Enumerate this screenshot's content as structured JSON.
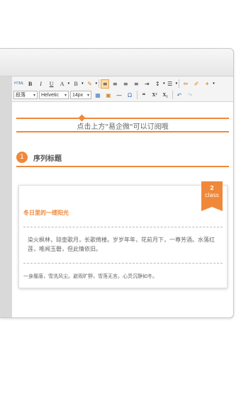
{
  "toolbar": {
    "row1": [
      {
        "name": "html-button",
        "label": "HTML"
      },
      {
        "name": "bold-button",
        "label": "B"
      },
      {
        "name": "italic-button",
        "label": "I"
      },
      {
        "name": "underline-button",
        "label": "U"
      },
      {
        "name": "font-color-button",
        "label": "A"
      },
      {
        "name": "background-color-button",
        "label": "B"
      },
      {
        "name": "format-brush-button",
        "label": "✎"
      },
      {
        "name": "align-left-button",
        "label": "≡"
      },
      {
        "name": "align-center-button",
        "label": "≡"
      },
      {
        "name": "align-right-button",
        "label": "≡"
      },
      {
        "name": "align-justify-button",
        "label": "≡"
      },
      {
        "name": "indent-button",
        "label": "⇥"
      },
      {
        "name": "line-height-button",
        "label": "↕"
      },
      {
        "name": "list-button",
        "label": "☰"
      },
      {
        "name": "eraser-button",
        "label": "✏"
      },
      {
        "name": "clear-format-button",
        "label": "✐"
      },
      {
        "name": "magic-button",
        "label": "✦"
      }
    ],
    "row2": {
      "paragraph_select": "段落",
      "font_select": "Helvetic",
      "size_select": "14px",
      "buttons": [
        {
          "name": "table-button",
          "label": "▦"
        },
        {
          "name": "image-button",
          "label": "▣"
        },
        {
          "name": "horizontal-rule-button",
          "label": "—"
        },
        {
          "name": "special-char-button",
          "label": "Ω"
        },
        {
          "name": "quote-button",
          "label": "❝"
        },
        {
          "name": "superscript-button",
          "label": "X²"
        },
        {
          "name": "subscript-button",
          "label": "X₂"
        },
        {
          "name": "undo-button",
          "label": "↶"
        },
        {
          "name": "redo-button",
          "label": "↷"
        }
      ]
    }
  },
  "content": {
    "banner_text": "点击上方\"易企微\"可以订阅哦",
    "section": {
      "number": "1",
      "title": "序列标题"
    },
    "card": {
      "badge_number": "2",
      "badge_label": "class",
      "title": "冬日里的一缕阳光",
      "paragraph": "染火枫林，琼壶歌月，长歌倚楼。岁岁年年，花前月下，一尊芳酒。水落红莲，唯闻玉磬，但此情依旧。",
      "footer": "一身履唐，雪洗风尘。避观旷野，雪落无言。心灵沉静如冬。"
    }
  },
  "colors": {
    "accent": "#f0883a"
  }
}
